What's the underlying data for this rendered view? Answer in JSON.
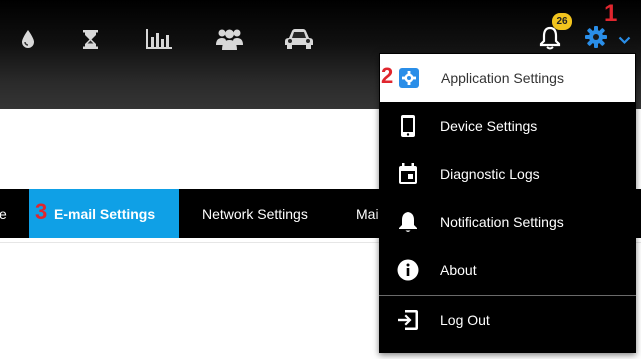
{
  "header": {
    "nav_icons": [
      "water-drop-icon",
      "hourglass-icon",
      "bar-chart-icon",
      "group-icon",
      "car-icon"
    ],
    "notification_count": "26"
  },
  "annotations": {
    "one": "1",
    "two": "2",
    "three": "3"
  },
  "tabs": [
    {
      "label": "e",
      "active": false
    },
    {
      "label": "E-mail Settings",
      "active": true
    },
    {
      "label": "Network Settings",
      "active": false
    },
    {
      "label": "Mai",
      "active": false
    }
  ],
  "menu": {
    "items": [
      {
        "label": "Application Settings",
        "icon": "gear-icon",
        "highlighted": true
      },
      {
        "label": "Device Settings",
        "icon": "smartphone-icon"
      },
      {
        "label": "Diagnostic Logs",
        "icon": "calendar-icon"
      },
      {
        "label": "Notification Settings",
        "icon": "bell-icon"
      },
      {
        "label": "About",
        "icon": "info-icon"
      },
      {
        "label": "Log Out",
        "icon": "exit-icon"
      }
    ]
  },
  "colors": {
    "accent_blue": "#0fa0e6",
    "gear_blue": "#2a8ee8",
    "badge_yellow": "#f2c41e",
    "annotation_red": "#e0262e"
  }
}
